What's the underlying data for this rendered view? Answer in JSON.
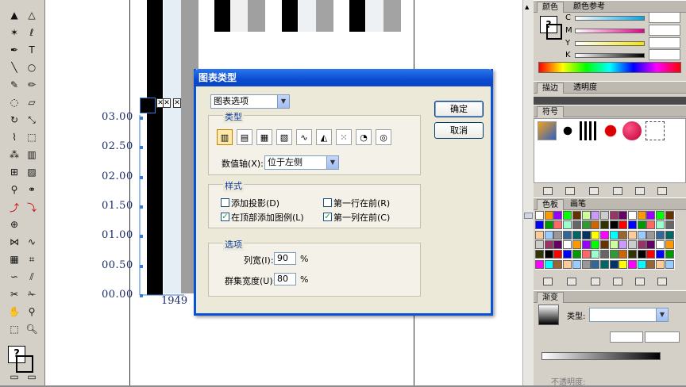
{
  "chart_data": {
    "type": "bar",
    "yticks": [
      "03.00",
      "02.50",
      "02.00",
      "01.50",
      "01.00",
      "00.50",
      "00.00"
    ],
    "xticks": [
      "1949"
    ]
  },
  "dialog": {
    "title": "图表类型",
    "dropdown": "图表选项",
    "ok": "确定",
    "cancel": "取消",
    "type_group": "类型",
    "value_axis_label": "数值轴(X):",
    "value_axis_value": "位于左侧",
    "style_group": "样式",
    "add_shadow": "添加投影(D)",
    "legend_top": "在顶部添加图例(L)",
    "first_row_front": "第一行在前(R)",
    "first_col_front": "第一列在前(C)",
    "options_group": "选项",
    "col_width_label": "列宽(I):",
    "col_width_value": "90",
    "cluster_width_label": "群集宽度(U):",
    "cluster_width_value": "80",
    "percent": "%"
  },
  "panels": {
    "color_tab": "颜色",
    "color_guide_tab": "颜色参考",
    "c": "C",
    "m": "M",
    "y": "Y",
    "k": "K",
    "stroke_tab": "描边",
    "transparency_tab": "透明度",
    "symbols_tab": "符号",
    "swatches_tab": "色板",
    "brushes_tab": "画笔",
    "gradient_tab": "渐变",
    "gradient_type_label": "类型:",
    "opacity_label": "不透明度:"
  },
  "colors": {
    "dialog_border": "#0a53d8",
    "axis_label": "#1a2a6a",
    "selection": "#3a7bd5"
  }
}
